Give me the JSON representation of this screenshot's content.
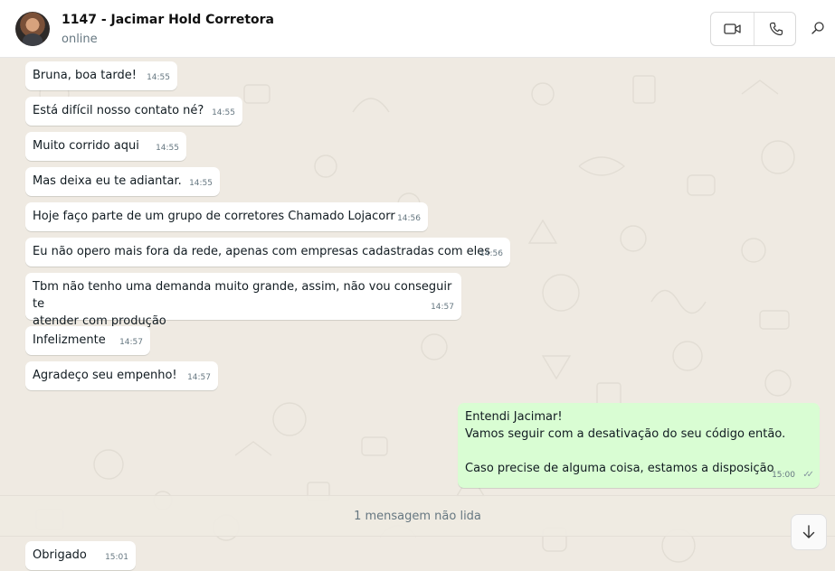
{
  "header": {
    "title": "1147 - Jacimar Hold Corretora",
    "status": "online",
    "icons": {
      "video": "video-camera-icon",
      "call": "phone-icon",
      "search": "search-icon"
    }
  },
  "messages": [
    {
      "text": "Bruna, boa tarde!",
      "time": "14:55",
      "direction": "in"
    },
    {
      "text": "Está difícil nosso contato né?",
      "time": "14:55",
      "direction": "in"
    },
    {
      "text": "Muito corrido aqui",
      "time": "14:55",
      "direction": "in"
    },
    {
      "text": "Mas deixa eu te adiantar.",
      "time": "14:55",
      "direction": "in"
    },
    {
      "text": "Hoje faço parte de um grupo de corretores Chamado Lojacorr",
      "time": "14:56",
      "direction": "in"
    },
    {
      "text": "Eu não opero mais fora da rede, apenas com empresas cadastradas com eles",
      "time": "14:56",
      "direction": "in"
    },
    {
      "text": "Tbm não tenho uma demanda muito grande, assim, não vou conseguir te\natender com produção",
      "time": "14:57",
      "direction": "in"
    },
    {
      "text": "Infelizmente",
      "time": "14:57",
      "direction": "in"
    },
    {
      "text": "Agradeço seu empenho!",
      "time": "14:57",
      "direction": "in"
    },
    {
      "text": "Entendi Jacimar!\nVamos seguir com a desativação do seu código então.\n\nCaso precise de alguma coisa, estamos a disposição",
      "time": "15:00",
      "direction": "out",
      "status_icon": "double-check-icon"
    },
    {
      "text": "Obrigado",
      "time": "15:01",
      "direction": "in"
    }
  ],
  "unread_divider": "1 mensagem não lida",
  "scroll_button_icon": "arrow-down-icon",
  "colors": {
    "incoming_bubble": "#ffffff",
    "outgoing_bubble": "#d9fdd3",
    "chat_background": "#efeae2",
    "meta_text": "#667781"
  }
}
